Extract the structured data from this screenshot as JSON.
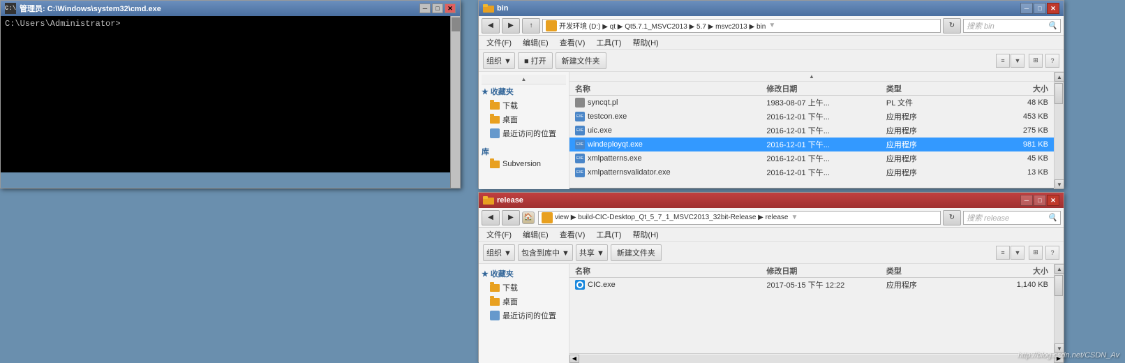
{
  "cmd": {
    "title": "管理员: C:\\Windows\\system32\\cmd.exe",
    "prompt": "C:\\Users\\Administrator>",
    "btns": {
      "minimize": "─",
      "maximize": "□",
      "close": "✕"
    }
  },
  "explorer1": {
    "title": "bin",
    "titlebar_btns": {
      "minimize": "─",
      "maximize": "□",
      "close": "✕"
    },
    "address": {
      "breadcrumb": "开发环境 (D:) ▶ qt ▶ Qt5.7.1_MSVC2013 ▶ 5.7 ▶ msvc2013 ▶ bin",
      "search_placeholder": "搜索 bin"
    },
    "menu": [
      "文件(F)",
      "编辑(E)",
      "查看(V)",
      "工具(T)",
      "帮助(H)"
    ],
    "toolbar": {
      "organize": "组织 ▼",
      "open": "■ 打开",
      "new_folder": "新建文件夹",
      "view_label": ""
    },
    "sidebar": {
      "groups": [
        {
          "header": "★ 收藏夹",
          "items": [
            "下载",
            "桌面",
            "最近访问的位置"
          ]
        },
        {
          "header": "库",
          "items": [
            "Subversion"
          ]
        }
      ]
    },
    "columns": [
      "名称",
      "修改日期",
      "类型",
      "大小"
    ],
    "files": [
      {
        "name": "syncqt.pl",
        "date": "1983-08-07 上午...",
        "type": "PL 文件",
        "size": "48 KB",
        "icon": "pl"
      },
      {
        "name": "testcon.exe",
        "date": "2016-12-01 下午...",
        "type": "应用程序",
        "size": "453 KB",
        "icon": "exe"
      },
      {
        "name": "uic.exe",
        "date": "2016-12-01 下午...",
        "type": "应用程序",
        "size": "275 KB",
        "icon": "exe"
      },
      {
        "name": "windeployqt.exe",
        "date": "2016-12-01 下午...",
        "type": "应用程序",
        "size": "981 KB",
        "icon": "exe",
        "selected": true
      },
      {
        "name": "xmlpatterns.exe",
        "date": "2016-12-01 下午...",
        "type": "应用程序",
        "size": "45 KB",
        "icon": "exe"
      },
      {
        "name": "xmlpatternsvalidator.exe",
        "date": "2016-12-01 下午...",
        "type": "应用程序",
        "size": "13 KB",
        "icon": "exe"
      }
    ]
  },
  "explorer2": {
    "title": "release",
    "titlebar_btns": {
      "minimize": "─",
      "maximize": "□",
      "close": "✕"
    },
    "address": {
      "breadcrumb": "view ▶ build-CIC-Desktop_Qt_5_7_1_MSVC2013_32bit-Release ▶ release",
      "search_placeholder": "搜索 release"
    },
    "menu": [
      "文件(F)",
      "编辑(E)",
      "查看(V)",
      "工具(T)",
      "帮助(H)"
    ],
    "toolbar": {
      "organize": "组织 ▼",
      "include_lib": "包含到库中 ▼",
      "share": "共享 ▼",
      "new_folder": "新建文件夹"
    },
    "sidebar": {
      "groups": [
        {
          "header": "★ 收藏夹",
          "items": [
            "下载",
            "桌面",
            "最近访问的位置"
          ]
        }
      ]
    },
    "columns": [
      "名称",
      "修改日期",
      "类型",
      "大小"
    ],
    "files": [
      {
        "name": "CIC.exe",
        "date": "2017-05-15 下午 12:22",
        "type": "应用程序",
        "size": "1,140 KB",
        "icon": "cic"
      }
    ]
  },
  "watermark": "http://blog.csdn.net/CSDN_Av"
}
